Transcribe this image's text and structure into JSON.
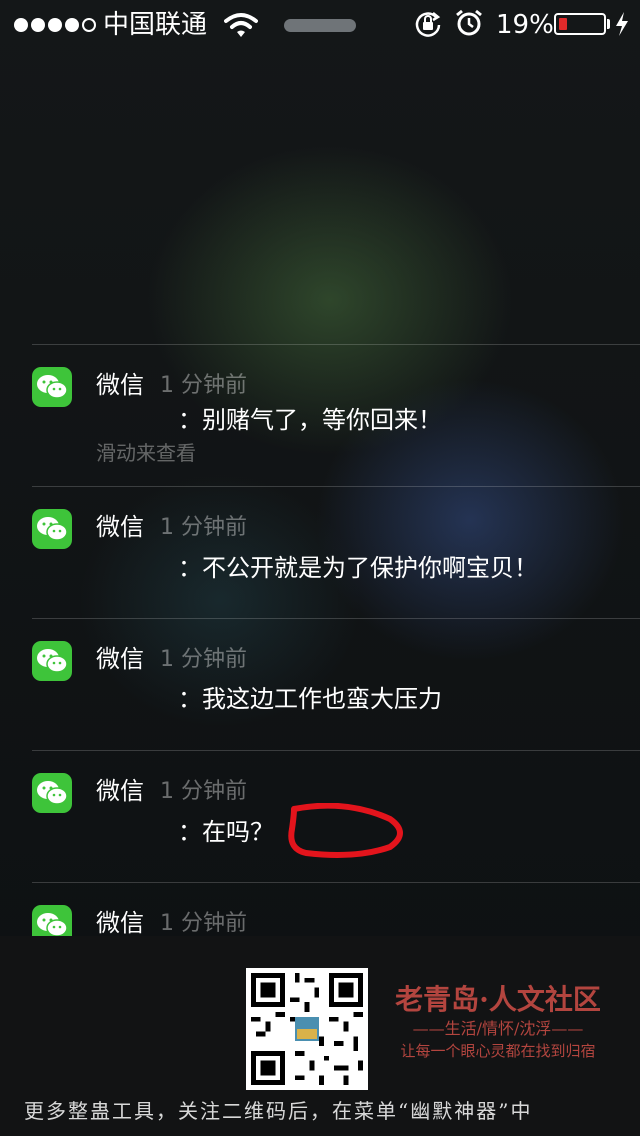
{
  "status_bar": {
    "signal_dots_filled": 4,
    "signal_dots_total": 5,
    "carrier": "中国联通",
    "battery_percent": "19%",
    "battery_level": 0.19,
    "battery_color": "#e02a2a",
    "icons": [
      "wifi-icon",
      "rotation-lock-icon",
      "alarm-icon",
      "charging-bolt-icon"
    ]
  },
  "notifications": [
    {
      "app": "微信",
      "time": "1 分钟前",
      "message": "：别赌气了，等你回来！",
      "hint": "滑动来查看"
    },
    {
      "app": "微信",
      "time": "1 分钟前",
      "message": "：不公开就是为了保护你啊宝贝！"
    },
    {
      "app": "微信",
      "time": "1 分钟前",
      "message": "：我这边工作也蛮大压力"
    },
    {
      "app": "微信",
      "time": "1 分钟前",
      "message": "：在吗？"
    },
    {
      "app": "微信",
      "time": "1 分钟前"
    }
  ],
  "watermark": {
    "title": "老青岛·人文社区",
    "subtitle": "——生活/情怀/沈浮——",
    "tagline": "让每一个眼心灵都在找到归宿",
    "footer": "更多整蛊工具，关注二维码后，在菜单“幽默神器”中"
  },
  "colors": {
    "wechat_green": "#3ec43a",
    "brand_red": "#b3453f",
    "annotation_red": "#e3141c"
  }
}
